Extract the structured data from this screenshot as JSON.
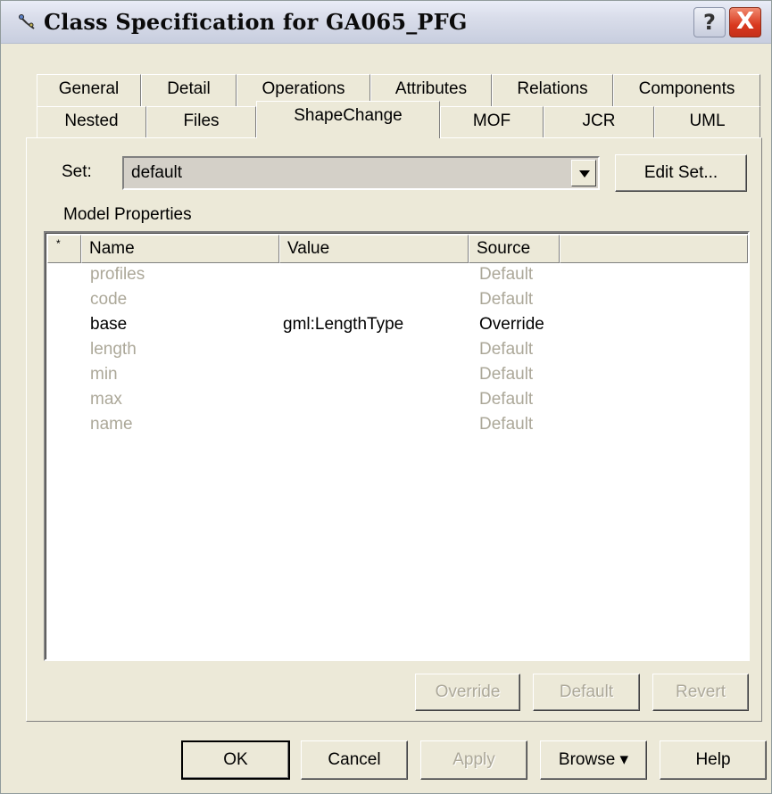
{
  "window": {
    "title": "Class Specification for GA065_PFG",
    "help_label": "?",
    "close_label": "X"
  },
  "tabs_row1": [
    "General",
    "Detail",
    "Operations",
    "Attributes",
    "Relations",
    "Components"
  ],
  "tabs_row2": [
    "Nested",
    "Files",
    "ShapeChange",
    "MOF",
    "JCR",
    "UML"
  ],
  "active_tab": "ShapeChange",
  "set": {
    "label": "Set:",
    "value": "default",
    "edit_label": "Edit Set..."
  },
  "model_properties_label": "Model Properties",
  "list": {
    "columns": [
      "*",
      "Name",
      "Value",
      "Source",
      ""
    ],
    "rows": [
      {
        "name": "profiles",
        "value": "",
        "source": "Default"
      },
      {
        "name": "code",
        "value": "",
        "source": "Default"
      },
      {
        "name": "base",
        "value": "gml:LengthType",
        "source": "Override"
      },
      {
        "name": "length",
        "value": "",
        "source": "Default"
      },
      {
        "name": "min",
        "value": "",
        "source": "Default"
      },
      {
        "name": "max",
        "value": "",
        "source": "Default"
      },
      {
        "name": "name",
        "value": "",
        "source": "Default"
      }
    ]
  },
  "panel_buttons": {
    "override": "Override",
    "default": "Default",
    "revert": "Revert"
  },
  "footer_buttons": {
    "ok": "OK",
    "cancel": "Cancel",
    "apply": "Apply",
    "browse": "Browse ▾",
    "help": "Help"
  }
}
